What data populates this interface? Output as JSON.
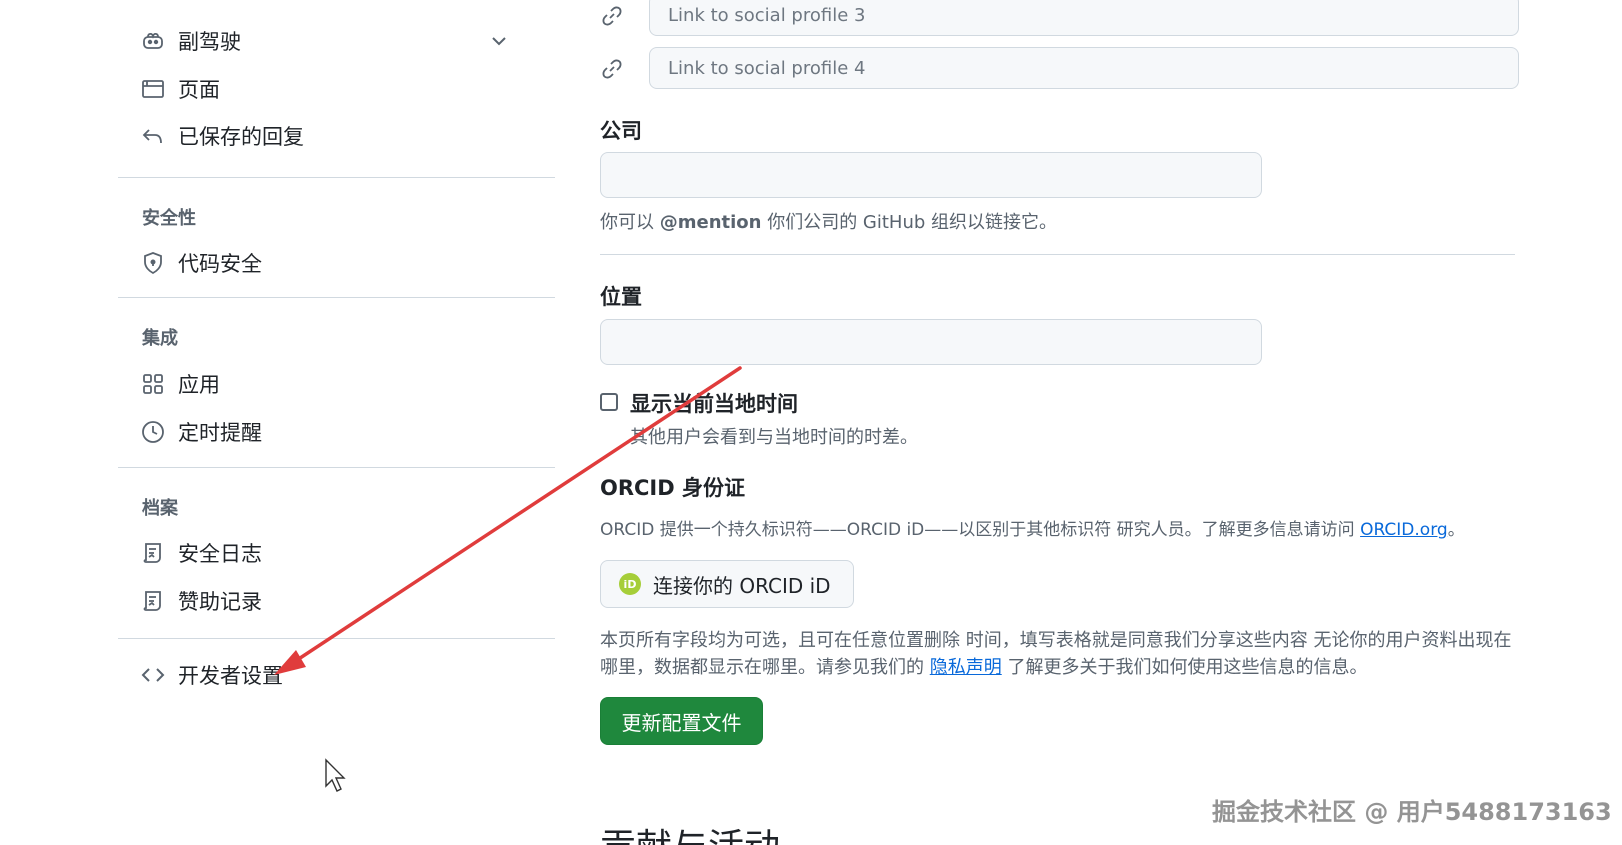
{
  "sidebar": {
    "items": [
      {
        "label": "副驾驶",
        "icon": "copilot-icon",
        "has_chevron": true
      },
      {
        "label": "页面",
        "icon": "browser-icon"
      },
      {
        "label": "已保存的回复",
        "icon": "reply-icon"
      }
    ],
    "security": {
      "heading": "安全性",
      "items": [
        {
          "label": "代码安全",
          "icon": "shield-icon"
        }
      ]
    },
    "integrations": {
      "heading": "集成",
      "items": [
        {
          "label": "应用",
          "icon": "apps-icon"
        },
        {
          "label": "定时提醒",
          "icon": "clock-icon"
        }
      ]
    },
    "archives": {
      "heading": "档案",
      "items": [
        {
          "label": "安全日志",
          "icon": "log-icon"
        },
        {
          "label": "赞助记录",
          "icon": "log-icon"
        }
      ]
    },
    "developer": {
      "label": "开发者设置",
      "icon": "code-icon"
    }
  },
  "profile": {
    "social_links": [
      {
        "placeholder": "Link to social profile 3",
        "icon": "link-icon"
      },
      {
        "placeholder": "Link to social profile 4",
        "icon": "link-icon"
      }
    ],
    "company": {
      "label": "公司",
      "value": "",
      "hint_pre": "你可以 ",
      "hint_bold": "@mention",
      "hint_post": " 你们公司的 GitHub 组织以链接它。"
    },
    "location": {
      "label": "位置",
      "value": ""
    },
    "local_time": {
      "label": "显示当前当地时间",
      "hint": "其他用户会看到与当地时间的时差。",
      "checked": false
    },
    "orcid": {
      "title": "ORCID 身份证",
      "desc_pre": "ORCID 提供一个持久标识符——ORCID iD——以区别于其他标识符 研究人员。了解更多信息请访问 ",
      "desc_link": "ORCID.org",
      "desc_post": "。",
      "button_label": "连接你的 ORCID iD",
      "badge": "iD",
      "badge_color": "#a6ce39"
    },
    "notice": {
      "text_pre": "本页所有字段均为可选，且可在任意位置删除 时间，填写表格就是同意我们分享这些内容 无论你的用户资料出现在哪里，数据都显示在哪里。请参见我们的 ",
      "link": "隐私声明",
      "text_post": " 了解更多关于我们如何使用这些信息的信息。"
    },
    "submit_label": "更新配置文件",
    "next_section_title": "贡献与活动"
  },
  "watermark": "掘金技术社区 @ 用户5488173163",
  "colors": {
    "primary_button": "#1f883d",
    "link": "#0969da",
    "annotation_arrow": "#e03c3c"
  }
}
